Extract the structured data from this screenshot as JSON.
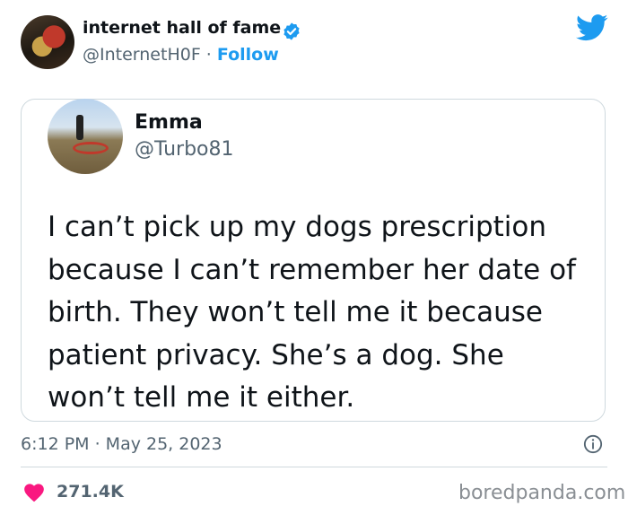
{
  "author": {
    "display_name": "internet hall of fame",
    "handle": "@InternetH0F",
    "separator": " · ",
    "follow_label": "Follow"
  },
  "quoted_tweet": {
    "display_name": "Emma",
    "handle": "@Turbo81",
    "text": "I can’t pick up my dogs prescription because I can’t remember her date of birth. They won’t tell me it because patient privacy. She’s a dog. She won’t tell me it either."
  },
  "footer": {
    "timestamp": "6:12 PM · May 25, 2023",
    "likes": "271.4K",
    "watermark": "boredpanda.com"
  },
  "icons": {
    "verified": "verified-badge-icon",
    "brand": "twitter-bird-icon",
    "info": "info-icon",
    "like": "heart-icon"
  },
  "colors": {
    "accent": "#1d9bf0",
    "heart": "#f91880",
    "secondary_text": "#536471",
    "border": "#cfd9de"
  }
}
